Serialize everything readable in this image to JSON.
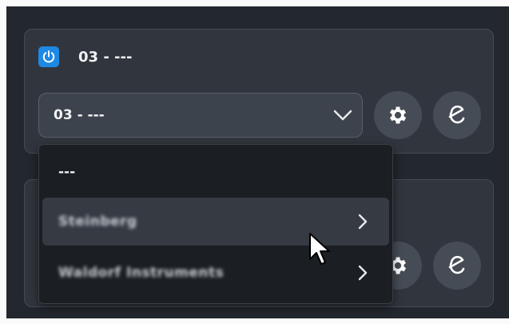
{
  "panels": [
    {
      "title": "03 - ---",
      "selected": "03 - ---"
    }
  ],
  "dropdown": {
    "items": [
      {
        "label": "---",
        "has_submenu": false
      },
      {
        "label": "Steinberg",
        "has_submenu": true
      },
      {
        "label": "Waldorf Instruments",
        "has_submenu": true
      }
    ]
  },
  "icons": {
    "power": "power-icon",
    "chevron": "chevron-down-icon",
    "settings": "gear-icon",
    "edit": "edit-e-icon",
    "submenu": "chevron-right-icon"
  },
  "colors": {
    "accent": "#1e88e5",
    "background": "#23272e",
    "panel": "#31363e",
    "menu": "#1b1e23",
    "highlight": "#353a43"
  }
}
